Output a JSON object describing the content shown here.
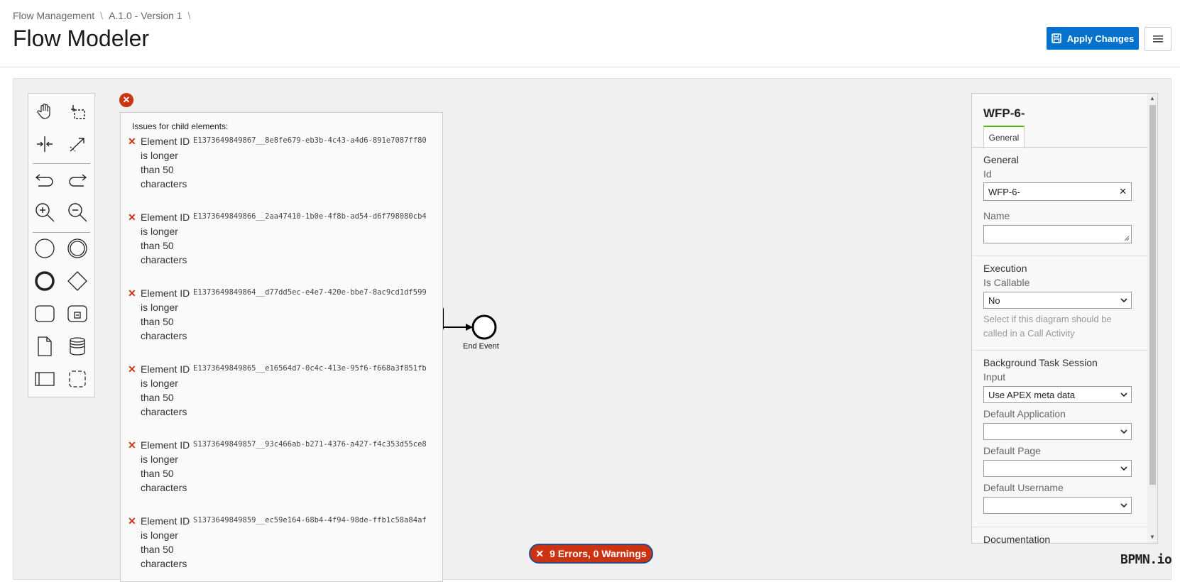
{
  "breadcrumb": {
    "items": [
      "Flow Management",
      "A.1.0 - Version 1"
    ],
    "sep": "\\"
  },
  "header": {
    "title": "Flow Modeler",
    "apply_label": "Apply Changes"
  },
  "issues": {
    "heading": "Issues for child elements:",
    "list": [
      {
        "message": "Element ID is longer than 50 characters",
        "id": "E1373649849867__8e8fe679-eb3b-4c43-a4d6-891e7087ff80"
      },
      {
        "message": "Element ID is longer than 50 characters",
        "id": "E1373649849866__2aa47410-1b0e-4f8b-ad54-d6f798080cb4"
      },
      {
        "message": "Element ID is longer than 50 characters",
        "id": "E1373649849864__d77dd5ec-e4e7-420e-bbe7-8ac9cd1df599"
      },
      {
        "message": "Element ID is longer than 50 characters",
        "id": "E1373649849865__e16564d7-0c4c-413e-95f6-f668a3f851fb"
      },
      {
        "message": "Element ID is longer than 50 characters",
        "id": "S1373649849857__93c466ab-b271-4376-a427-f4c353d55ce8"
      },
      {
        "message": "Element ID is longer than 50 characters",
        "id": "S1373649849859__ec59e164-68b4-4f94-98de-ffb1c58a84af"
      }
    ]
  },
  "diagram": {
    "end_event_label": "End Event"
  },
  "status": {
    "text": "9 Errors, 0 Warnings"
  },
  "logo": "BPMN.io",
  "properties": {
    "title": "WFP-6-",
    "tab": "General",
    "general": {
      "section": "General",
      "id_label": "Id",
      "id_value": "WFP-6-",
      "name_label": "Name",
      "name_value": ""
    },
    "execution": {
      "section": "Execution",
      "callable_label": "Is Callable",
      "callable_value": "No",
      "hint": "Select if this diagram should be called in a Call Activity"
    },
    "background": {
      "section": "Background Task Session",
      "input_label": "Input",
      "input_value": "Use APEX meta data",
      "app_label": "Default Application",
      "app_value": "",
      "page_label": "Default Page",
      "page_value": "",
      "user_label": "Default Username",
      "user_value": ""
    },
    "documentation": {
      "section": "Documentation"
    }
  },
  "colors": {
    "accent": "#0572ce",
    "error": "#cc3311",
    "tab_active": "#52b415"
  }
}
